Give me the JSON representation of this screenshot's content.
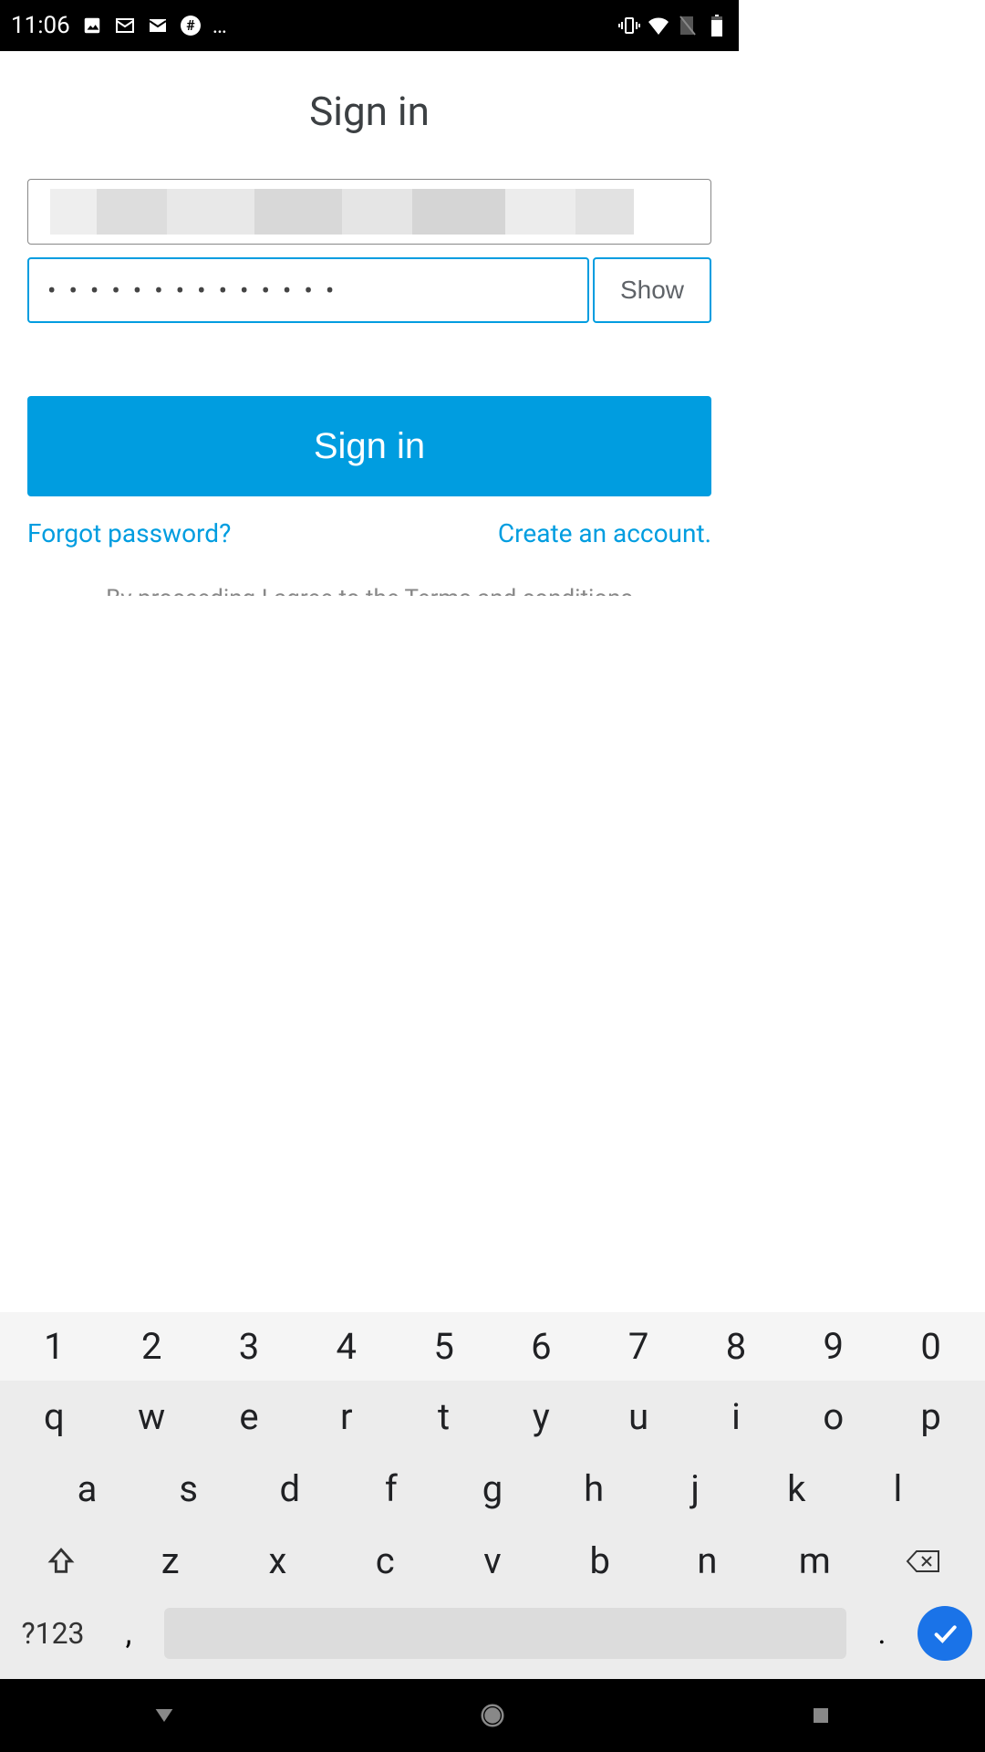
{
  "status": {
    "time": "11:06",
    "icons_left": [
      "gallery-icon",
      "mail-outline-icon",
      "mail-icon",
      "hash-icon"
    ],
    "overflow": "…"
  },
  "signin": {
    "title": "Sign in",
    "password_masked": "••••••••••••••",
    "show_label": "Show",
    "signin_button": "Sign in",
    "forgot_link": "Forgot password?",
    "create_link": "Create an account.",
    "terms_partial": "By proceeding I agree to the Terms and conditions"
  },
  "keyboard": {
    "row_num": [
      "1",
      "2",
      "3",
      "4",
      "5",
      "6",
      "7",
      "8",
      "9",
      "0"
    ],
    "row1": [
      "q",
      "w",
      "e",
      "r",
      "t",
      "y",
      "u",
      "i",
      "o",
      "p"
    ],
    "row2": [
      "a",
      "s",
      "d",
      "f",
      "g",
      "h",
      "j",
      "k",
      "l"
    ],
    "row3": [
      "z",
      "x",
      "c",
      "v",
      "b",
      "n",
      "m"
    ],
    "mode": "?123",
    "comma": ",",
    "period": "."
  }
}
